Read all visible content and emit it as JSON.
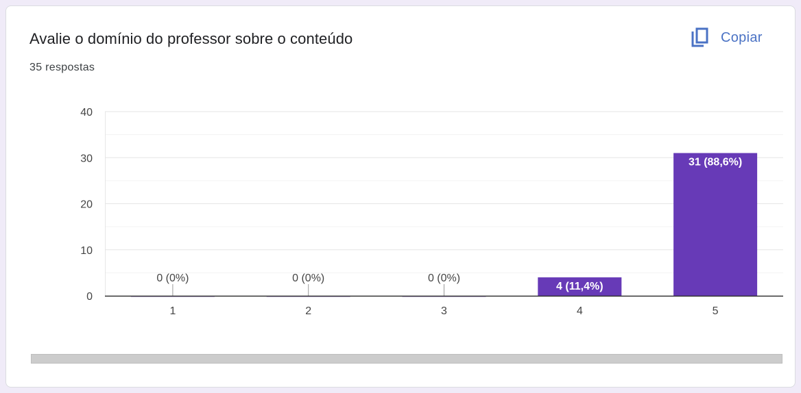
{
  "header": {
    "title": "Avalie o domínio do professor sobre o conteúdo",
    "responses": "35 respostas",
    "copy_label": "Copiar",
    "copy_icon": "copy-icon"
  },
  "colors": {
    "bar": "#673ab7",
    "accent": "#4a72c4"
  },
  "chart_data": {
    "type": "bar",
    "categories": [
      "1",
      "2",
      "3",
      "4",
      "5"
    ],
    "values": [
      0,
      0,
      0,
      4,
      31
    ],
    "data_labels": [
      "0 (0%)",
      "0 (0%)",
      "0 (0%)",
      "4 (11,4%)",
      "31 (88,6%)"
    ],
    "yticks": [
      "0",
      "10",
      "20",
      "30",
      "40"
    ],
    "ylim": [
      0,
      40
    ],
    "grid": true,
    "xlabel": "",
    "ylabel": "",
    "title": ""
  }
}
